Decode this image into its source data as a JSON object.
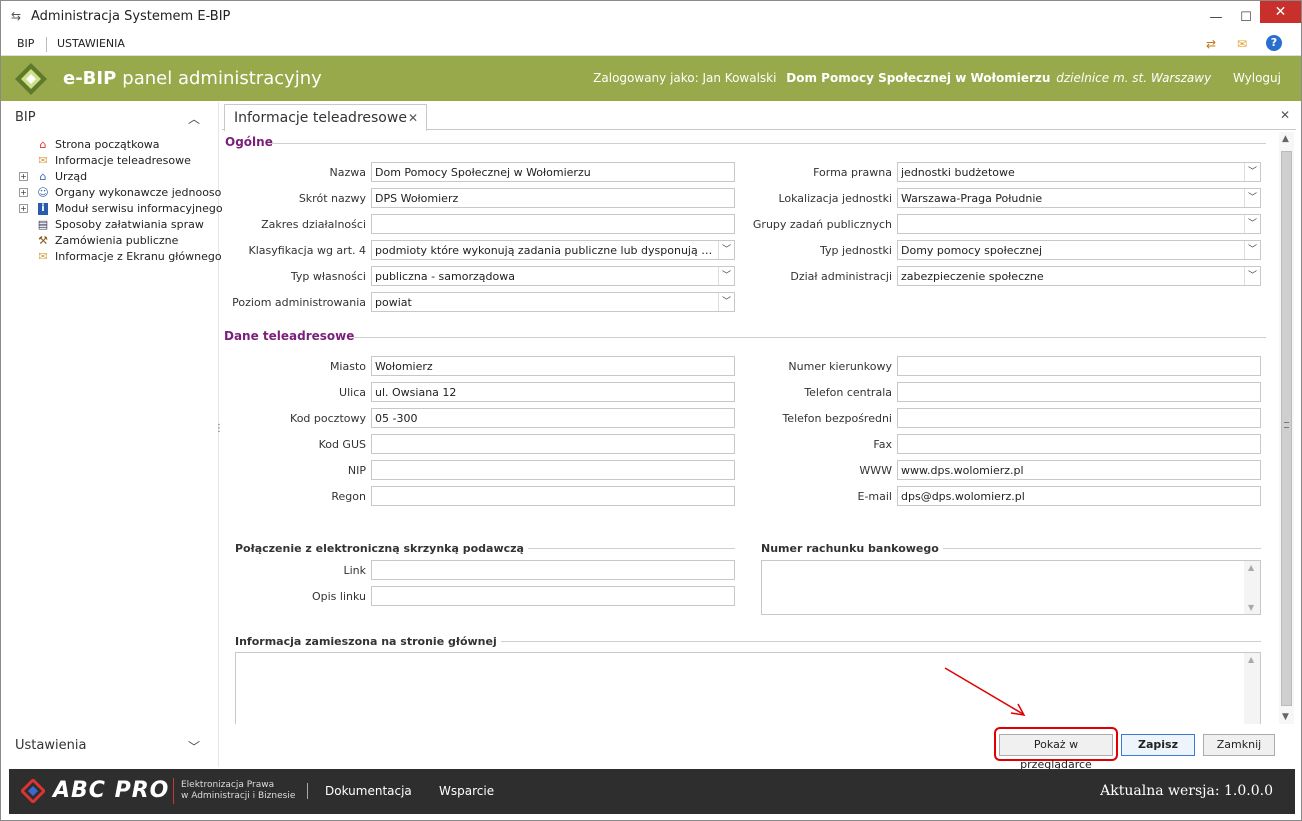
{
  "window": {
    "title": "Administracja Systemem E-BIP"
  },
  "menu": {
    "items": [
      "BIP",
      "USTAWIENIA"
    ]
  },
  "banner": {
    "brand_bold": "e-BIP",
    "brand_rest": "panel administracyjny",
    "logged_as": "Zalogowany jako: Jan Kowalski",
    "org": "Dom Pomocy Społecznej w Wołomierzu",
    "district": "dzielnice m. st. Warszawy",
    "logout": "Wyloguj"
  },
  "sidebar": {
    "section_bip": "BIP",
    "section_settings": "Ustawienia",
    "items": [
      {
        "label": "Strona początkowa",
        "icon": "home-icon",
        "expandable": false
      },
      {
        "label": "Informacje teleadresowe",
        "icon": "envelope-icon",
        "expandable": false
      },
      {
        "label": "Urząd",
        "icon": "building-icon",
        "expandable": true
      },
      {
        "label": "Organy wykonawcze jednoosol",
        "icon": "person-icon",
        "expandable": true
      },
      {
        "label": "Moduł serwisu informacyjnego",
        "icon": "info-icon",
        "expandable": true
      },
      {
        "label": "Sposoby załatwiania spraw",
        "icon": "document-person-icon",
        "expandable": false
      },
      {
        "label": "Zamówienia publiczne",
        "icon": "gavel-icon",
        "expandable": false
      },
      {
        "label": "Informacje z Ekranu głównego",
        "icon": "envelope-icon",
        "expandable": false
      }
    ]
  },
  "tab": {
    "label": "Informacje teleadresowe"
  },
  "general": {
    "title": "Ogólne",
    "left": [
      {
        "label": "Nazwa",
        "value": "Dom Pomocy Społecznej w Wołomierzu",
        "type": "input"
      },
      {
        "label": "Skrót nazwy",
        "value": "DPS Wołomierz",
        "type": "input"
      },
      {
        "label": "Zakres działalności",
        "value": "",
        "type": "input"
      },
      {
        "label": "Klasyfikacja wg art. 4",
        "value": "podmioty które wykonują zadania publiczne lub dysponują majątkiem…",
        "type": "select"
      },
      {
        "label": "Typ własności",
        "value": "publiczna - samorządowa",
        "type": "select"
      },
      {
        "label": "Poziom administrowania",
        "value": "powiat",
        "type": "select"
      }
    ],
    "right": [
      {
        "label": "Forma prawna",
        "value": "jednostki budżetowe",
        "type": "select"
      },
      {
        "label": "Lokalizacja jednostki",
        "value": "Warszawa-Praga Południe",
        "type": "select"
      },
      {
        "label": "Grupy zadań publicznych",
        "value": "",
        "type": "select"
      },
      {
        "label": "Typ jednostki",
        "value": "Domy pomocy społecznej",
        "type": "select"
      },
      {
        "label": "Dział administracji",
        "value": "zabezpieczenie społeczne",
        "type": "select"
      }
    ]
  },
  "contact": {
    "title": "Dane teleadresowe",
    "left": [
      {
        "label": "Miasto",
        "value": "Wołomierz"
      },
      {
        "label": "Ulica",
        "value": "ul. Owsiana 12"
      },
      {
        "label": "Kod pocztowy",
        "value": "05 -300"
      },
      {
        "label": "Kod GUS",
        "value": ""
      },
      {
        "label": "NIP",
        "value": ""
      },
      {
        "label": "Regon",
        "value": ""
      }
    ],
    "right": [
      {
        "label": "Numer kierunkowy",
        "value": ""
      },
      {
        "label": "Telefon centrala",
        "value": ""
      },
      {
        "label": "Telefon bezpośredni",
        "value": ""
      },
      {
        "label": "Fax",
        "value": ""
      },
      {
        "label": "WWW",
        "value": "www.dps.wolomierz.pl"
      },
      {
        "label": "E-mail",
        "value": "dps@dps.wolomierz.pl"
      }
    ]
  },
  "mailbox": {
    "title": "Połączenie z elektroniczną skrzynką podawczą",
    "link_label": "Link",
    "link_value": "",
    "desc_label": "Opis linku",
    "desc_value": ""
  },
  "bank": {
    "title": "Numer rachunku bankowego"
  },
  "homepage_info": {
    "title": "Informacja zamieszona na stronie głównej"
  },
  "buttons": {
    "preview": "Pokaż w przeglądarce",
    "save": "Zapisz",
    "close": "Zamknij"
  },
  "footer": {
    "brand": "ABC PRO",
    "tagline_1": "Elektronizacja Prawa",
    "tagline_2": "w Administracji i Biznesie",
    "links": [
      "Dokumentacja",
      "Wsparcie"
    ],
    "version": "Aktualna wersja: 1.0.0.0"
  },
  "colors": {
    "banner": "#97a94a",
    "section_title": "#7a1f7a",
    "footer": "#2e2e2e",
    "highlight": "#e00000",
    "primary_border": "#3d7bd3"
  }
}
